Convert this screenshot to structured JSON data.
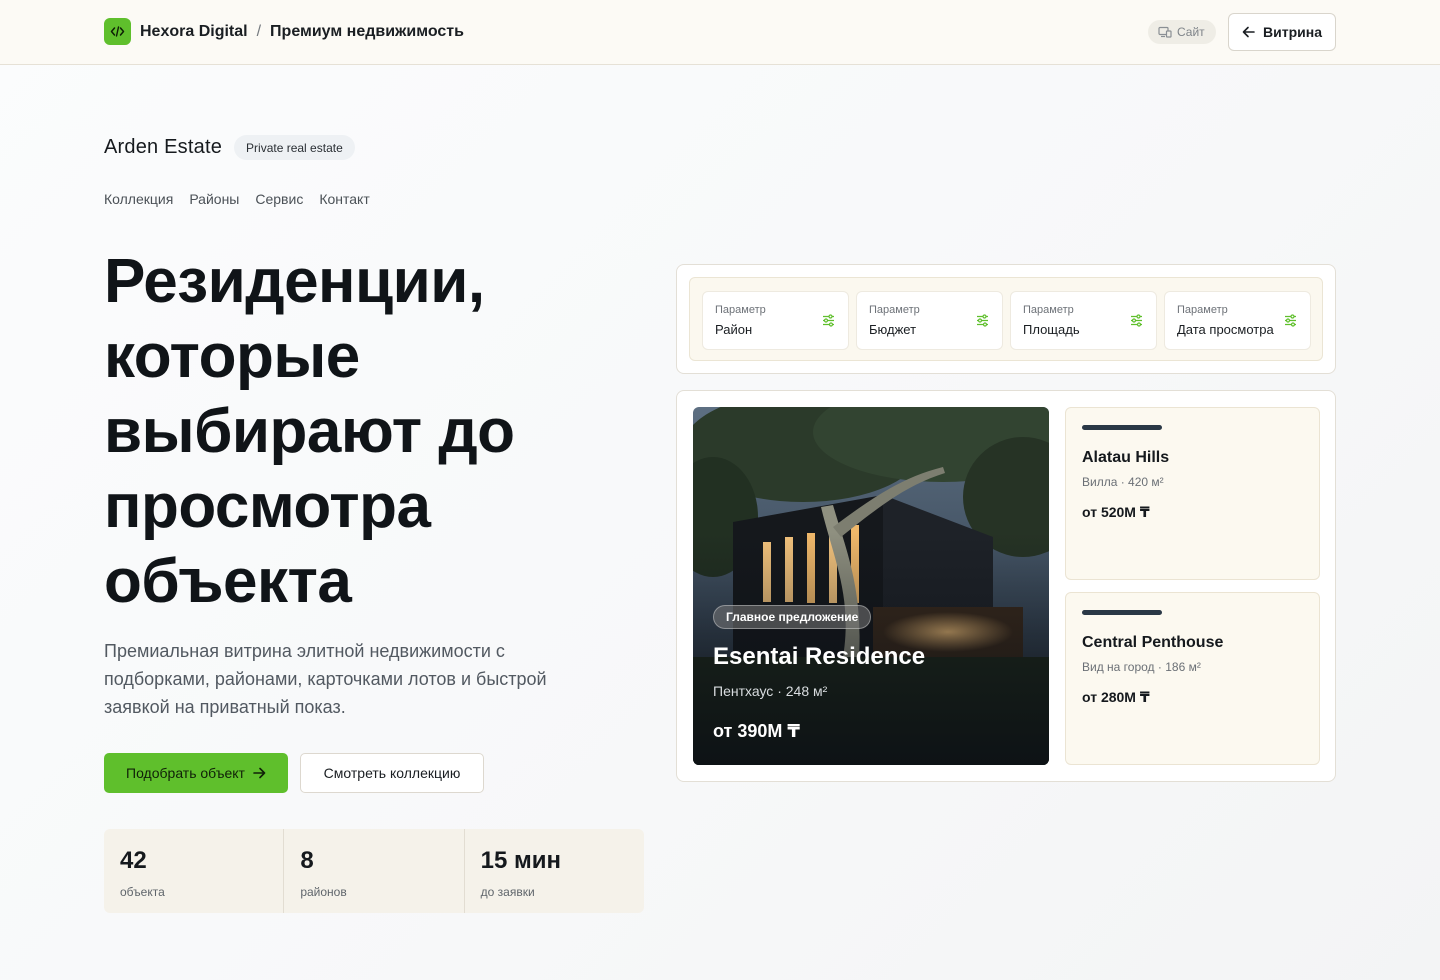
{
  "topbar": {
    "brand": "Hexora Digital",
    "separator": "/",
    "section": "Премиум недвижимость",
    "site_label": "Сайт",
    "back_label": "Витрина"
  },
  "estate": {
    "name": "Arden Estate",
    "badge": "Private real estate",
    "nav": [
      "Коллекция",
      "Районы",
      "Сервис",
      "Контакт"
    ]
  },
  "hero": {
    "title": "Резиденции, которые выбирают до просмотра объекта",
    "subtitle": "Премиальная витрина элитной недвижимости с подборками, районами, карточками лотов и быстрой заявкой на приватный показ.",
    "primary_cta": "Подобрать объект",
    "secondary_cta": "Смотреть коллекцию"
  },
  "stats": [
    {
      "value": "42",
      "label": "объекта"
    },
    {
      "value": "8",
      "label": "районов"
    },
    {
      "value": "15 мин",
      "label": "до заявки"
    }
  ],
  "filters": [
    {
      "label": "Параметр",
      "value": "Район"
    },
    {
      "label": "Параметр",
      "value": "Бюджет"
    },
    {
      "label": "Параметр",
      "value": "Площадь"
    },
    {
      "label": "Параметр",
      "value": "Дата просмотра"
    }
  ],
  "featured": {
    "badge": "Главное предложение",
    "title": "Esentai Residence",
    "meta": "Пентхаус · 248 м²",
    "price": "от 390M ₸"
  },
  "listings": [
    {
      "title": "Alatau Hills",
      "meta": "Вилла · 420 м²",
      "price": "от 520M ₸"
    },
    {
      "title": "Central Penthouse",
      "meta": "Вид на город · 186 м²",
      "price": "от 280M ₸"
    }
  ],
  "colors": {
    "accent": "#5fbf2c",
    "ink": "#101418",
    "cream": "#fcf9f0"
  }
}
